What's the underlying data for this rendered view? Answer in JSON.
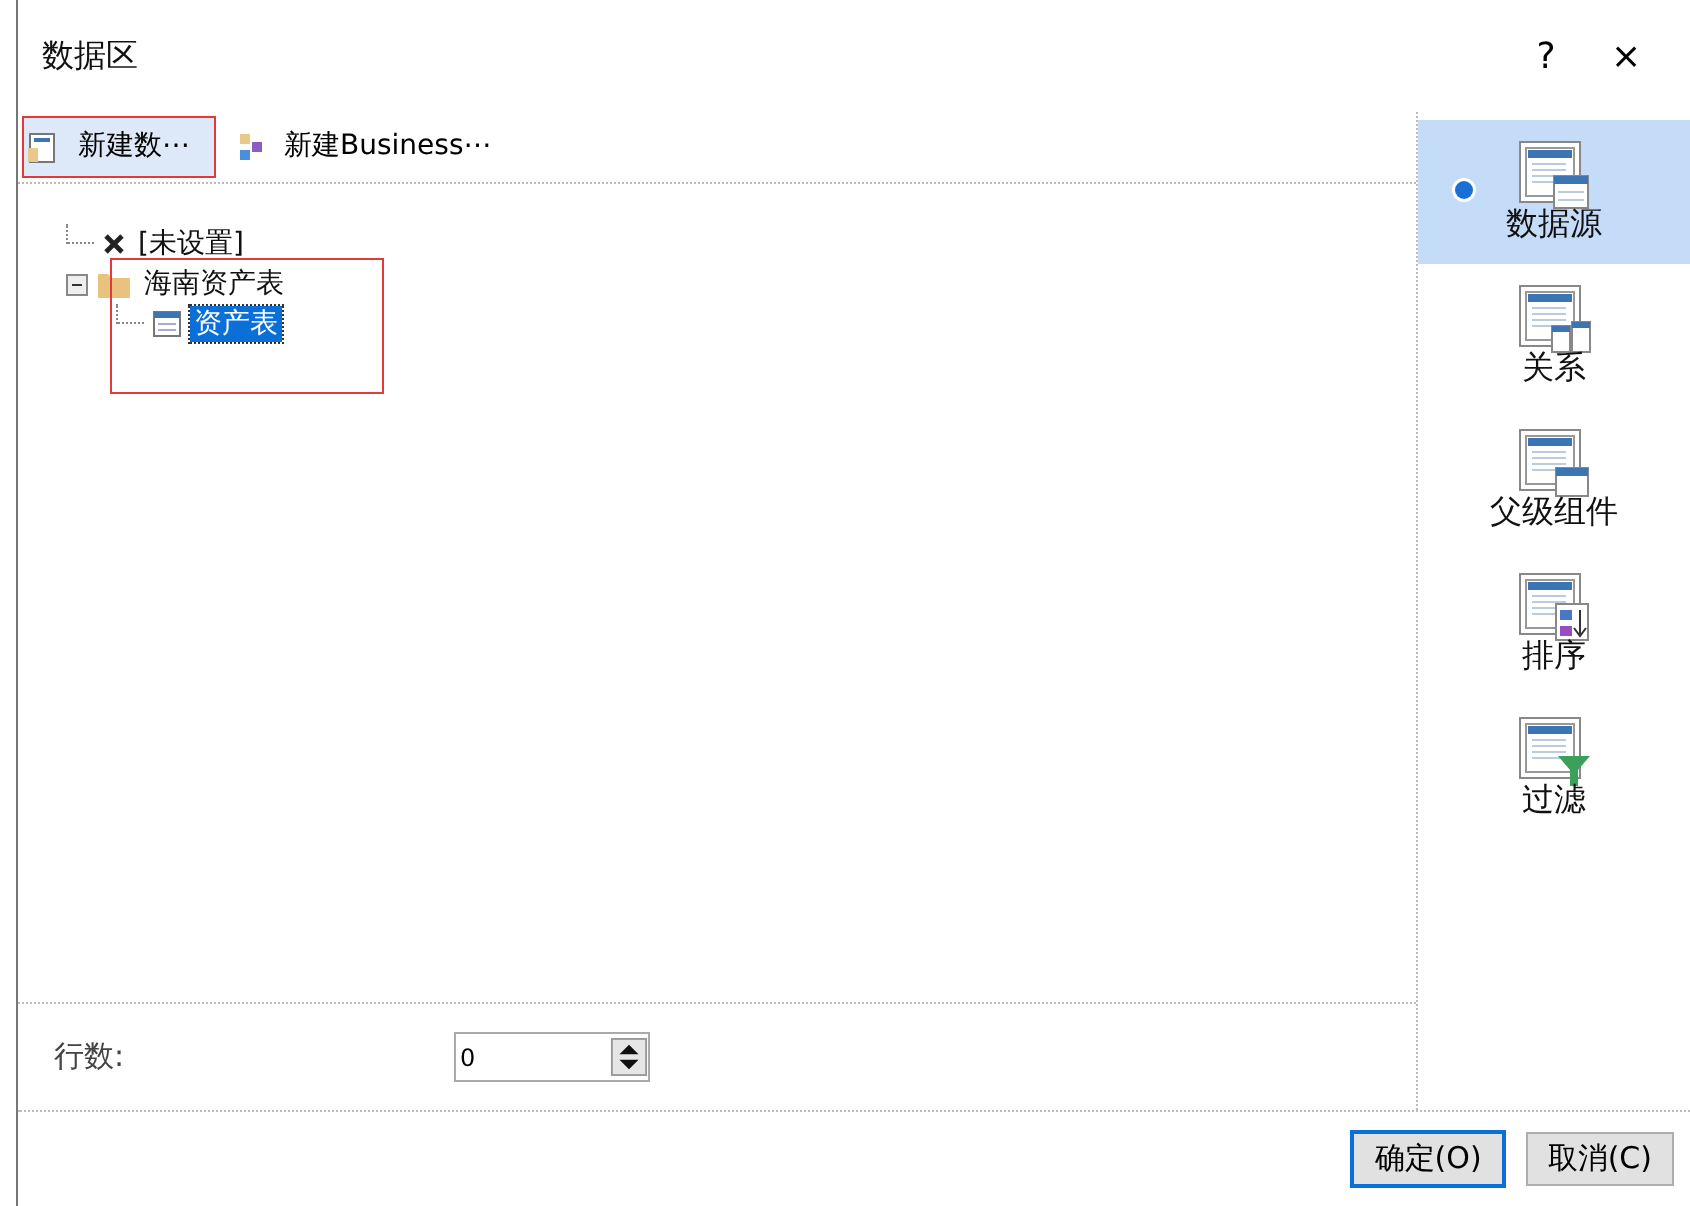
{
  "window": {
    "title": "数据区",
    "help": "?",
    "close": "×"
  },
  "toolbar": [
    {
      "label": "新建数⋯",
      "kind": "dataset",
      "highlighted": true
    },
    {
      "label": "新建Business⋯",
      "kind": "business",
      "highlighted": false
    }
  ],
  "tree": [
    {
      "label": "[未设置]",
      "kind": "none",
      "selected": false,
      "highlighted": false
    },
    {
      "label": "海南资产表",
      "kind": "folder",
      "expanded": true,
      "selected": false,
      "highlighted": true,
      "children": [
        {
          "label": "资产表",
          "kind": "table",
          "selected": true,
          "highlighted": false
        }
      ]
    }
  ],
  "side": [
    {
      "label": "数据源",
      "kind": "datasource",
      "selected": true
    },
    {
      "label": "关系",
      "kind": "relation",
      "selected": false
    },
    {
      "label": "父级组件",
      "kind": "parent",
      "selected": false
    },
    {
      "label": "排序",
      "kind": "sort",
      "selected": false
    },
    {
      "label": "过滤",
      "kind": "filter",
      "selected": false
    }
  ],
  "row_count": {
    "label": "行数:",
    "value": "0"
  },
  "buttons": [
    {
      "label": "确定(O)",
      "default": true
    },
    {
      "label": "取消(C)",
      "default": false
    }
  ]
}
